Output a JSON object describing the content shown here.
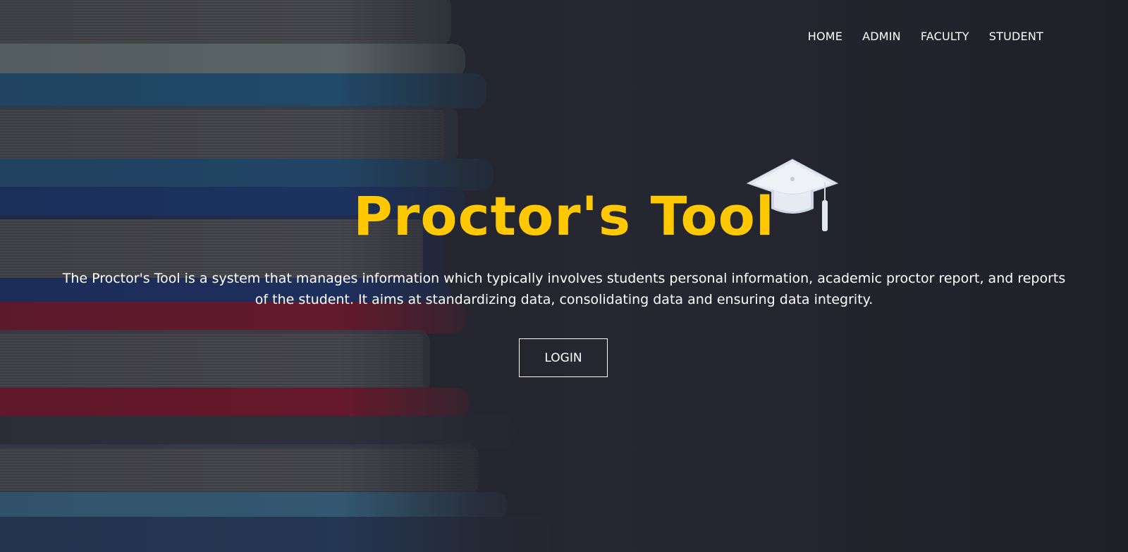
{
  "nav": {
    "items": [
      "HOME",
      "ADMIN",
      "FACULTY",
      "STUDENT"
    ]
  },
  "hero": {
    "title": "Proctor's Tool",
    "description": "The Proctor's Tool is a system that manages information which typically involves students personal information, academic proctor report, and reports of the student. It aims at standardizing data, consolidating data and ensuring data integrity.",
    "login_label": "LOGIN"
  },
  "icons": {
    "cap": "graduation-cap-icon"
  },
  "colors": {
    "title": "#ffc800",
    "background": "#2a2c36",
    "text": "#ffffff"
  }
}
